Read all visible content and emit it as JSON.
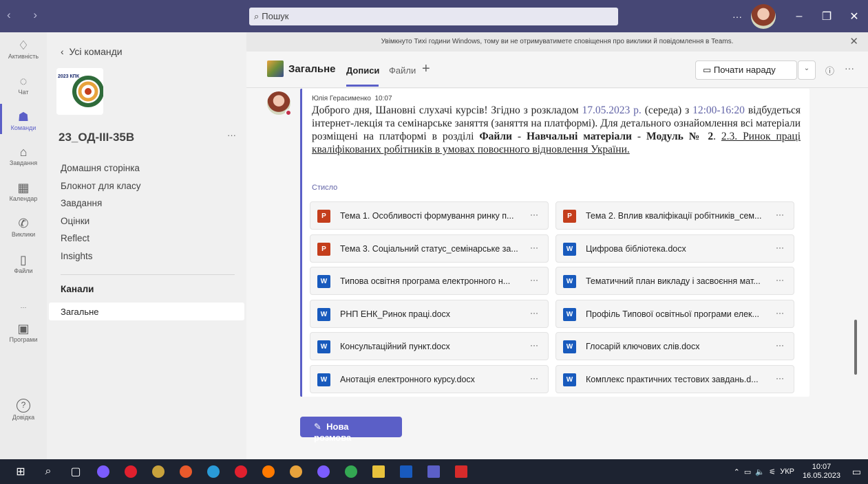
{
  "window": {
    "search_placeholder": "Пошук",
    "more": "···"
  },
  "rail": [
    {
      "label": "Активність",
      "icon": "bell-icon"
    },
    {
      "label": "Чат",
      "icon": "chat-icon"
    },
    {
      "label": "Команди",
      "icon": "teams-icon",
      "active": true
    },
    {
      "label": "Завдання",
      "icon": "assignments-icon"
    },
    {
      "label": "Календар",
      "icon": "calendar-icon"
    },
    {
      "label": "Виклики",
      "icon": "phone-icon"
    },
    {
      "label": "Файли",
      "icon": "file-icon"
    },
    {
      "label": "···",
      "icon": "more-icon"
    },
    {
      "label": "Програми",
      "icon": "apps-icon"
    }
  ],
  "help_label": "Довідка",
  "panel": {
    "back": "Усі команди",
    "team_name": "23_ОД-ІІІ-35В",
    "team_more": "···",
    "menu": [
      "Домашня сторінка",
      "Блокнот для класу",
      "Завдання",
      "Оцінки",
      "Reflect",
      "Insights"
    ],
    "channels_header": "Канали",
    "channel": "Загальне",
    "logo_text": "2023 КПК"
  },
  "notice": "Увімкнуто Тихі години Windows, тому ви не отримуватимете сповіщення про виклики й повідомлення в Teams.",
  "channel_header": {
    "name": "Загальне",
    "tab_posts": "Дописи",
    "tab_files": "Файли",
    "meet": "Почати нараду"
  },
  "post": {
    "author": "Юлія Герасименко",
    "time": "10:07",
    "text_1": "Доброго дня, Шановні слухачі курсів! Згідно з розкладом ",
    "date": "17.05.2023 р.",
    "text_2": " (середа) з ",
    "hours": "12:00-16:20",
    "text_3": " відбудеться інтернет-лекція та семінарське заняття (заняття на платформі). Для детального ознайомлення всі матеріали розміщені на платформі в розділі ",
    "bold_1": "Файли",
    "sep": " - ",
    "bold_2": "Навчальні матеріали",
    "bold_3": "Модуль № 2",
    "text_4": ". ",
    "underlined": "2.3. Ринок праці кваліфікованих робітників в умовах повоєнного відновлення України.",
    "collapse": "Стисло"
  },
  "files": [
    {
      "name": "Тема 1. Особливості формування ринку п...",
      "type": "ppt"
    },
    {
      "name": "Тема 2. Вплив кваліфікації робітників_сем...",
      "type": "ppt"
    },
    {
      "name": "Тема 3. Соціальний статус_семінарське за...",
      "type": "ppt"
    },
    {
      "name": "Цифрова бібліотека.docx",
      "type": "doc"
    },
    {
      "name": "Типова освітня програма електронного н...",
      "type": "doc"
    },
    {
      "name": "Тематичний план викладу і засвоєння мат...",
      "type": "doc"
    },
    {
      "name": "РНП ЕНК_Ринок праці.docx",
      "type": "doc"
    },
    {
      "name": "Профіль Типової освітньої програми елек...",
      "type": "doc"
    },
    {
      "name": "Консультаційний пункт.docx",
      "type": "doc"
    },
    {
      "name": "Глосарій ключових слів.docx",
      "type": "doc"
    },
    {
      "name": "Анотація електронного курсу.docx",
      "type": "doc"
    },
    {
      "name": "Комплекс практичних тестових завдань.d...",
      "type": "doc"
    }
  ],
  "new_conversation": "Нова розмова",
  "taskbar": {
    "lang": "УКР",
    "time": "10:07",
    "date": "16.05.2023"
  }
}
